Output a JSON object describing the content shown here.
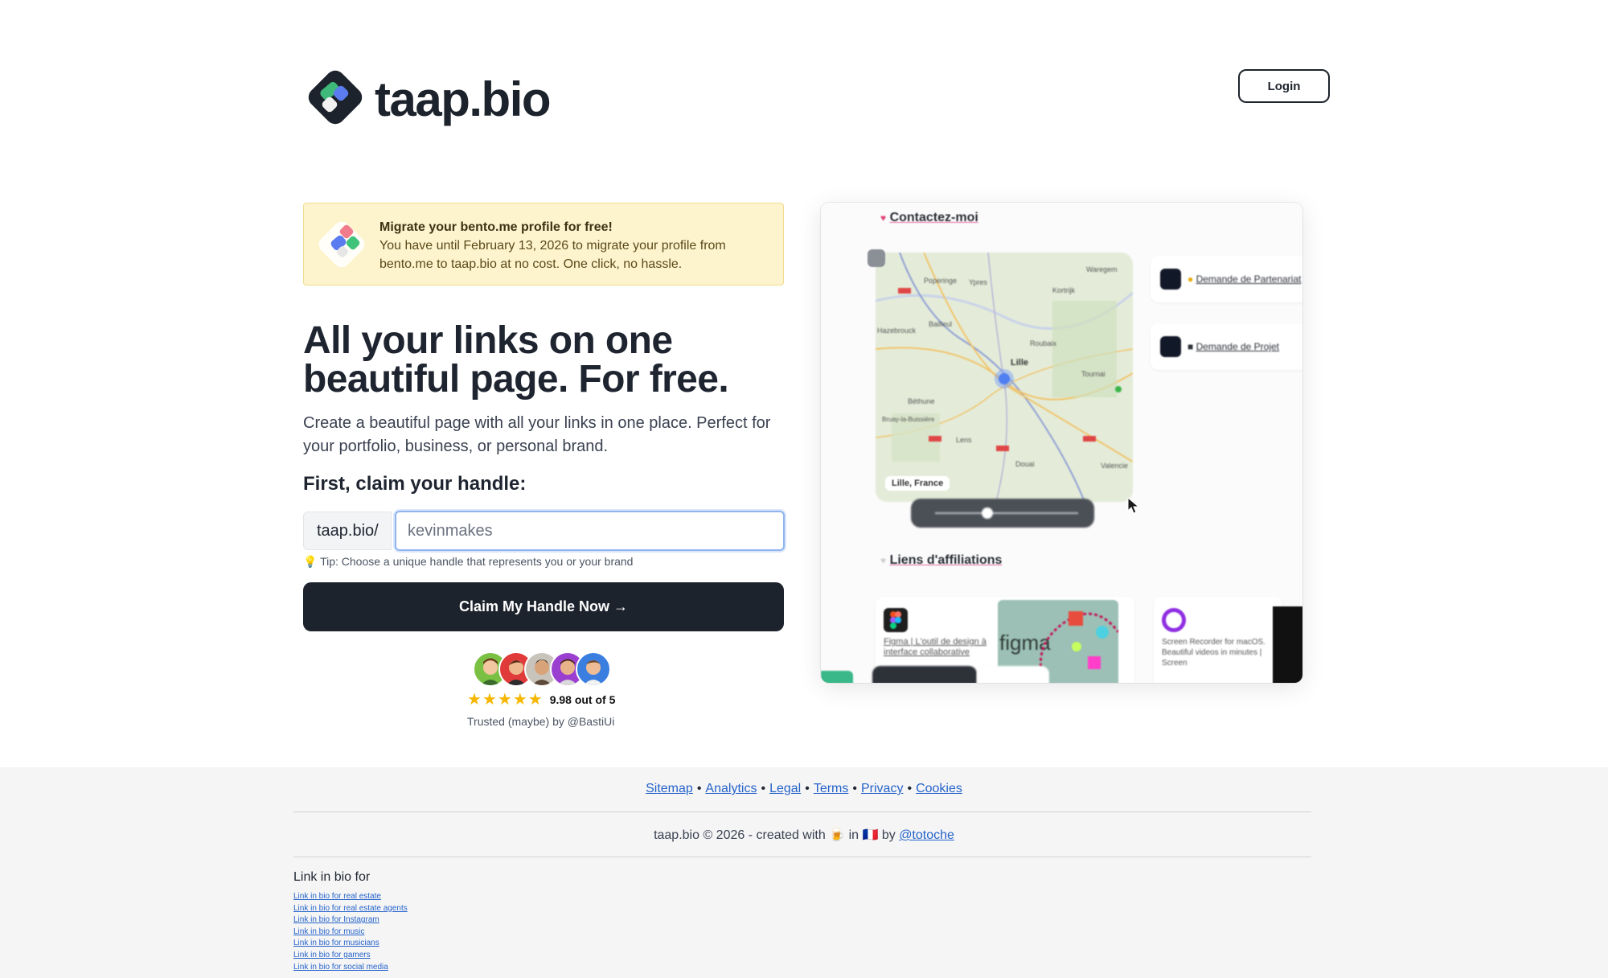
{
  "header": {
    "brand": "taap.bio",
    "login_label": "Login"
  },
  "banner": {
    "title": "Migrate your bento.me profile for free!",
    "body": "You have until February 13, 2026 to migrate your profile from bento.me to taap.bio at no cost. One click, no hassle."
  },
  "hero": {
    "headline": "All your links on one beautiful page. For free.",
    "subtext": "Create a beautiful page with all your links in one place. Perfect for your portfolio, business, or personal brand.",
    "claim_label": "First, claim your handle:",
    "prefix": "taap.bio/",
    "input_placeholder": "kevinmakes",
    "tip": "💡 Tip: Choose a unique handle that represents you or your brand",
    "cta_label": "Claim My Handle Now →"
  },
  "social_proof": {
    "rating": "9.98 out of 5",
    "stars": 5,
    "trusted": "Trusted (maybe) by @BastiUi"
  },
  "preview": {
    "section_contact": "Contactez-moi",
    "map_label": "Lille, France",
    "tile_partner": "Demande de Partenariat",
    "tile_project": "Demande de Projet",
    "section_affiliates": "Liens d'affiliations",
    "figma_text": "Figma | L'outil de design à interface collaborative",
    "figma_image_text": "figma",
    "screen_recorder_text": "Screen Recorder for macOS. Beautiful videos in minutes | Screen",
    "map_places": [
      "Poperinge",
      "Ypres",
      "Kortrijk",
      "Waregem",
      "Hazebrouck",
      "Bailleul",
      "Roubaix",
      "Lille",
      "Tournai",
      "Béthune",
      "Bruay-la-Buissière",
      "Lens",
      "Douai",
      "Valencie"
    ]
  },
  "footer": {
    "links": [
      "Sitemap",
      "Analytics",
      "Legal",
      "Terms",
      "Privacy",
      "Cookies"
    ],
    "copyright_prefix": "taap.bio © 2026 - created with 🍺 in 🇫🇷 by",
    "author": "@totoche",
    "lib_heading": "Link in bio for",
    "lib_links": [
      "Link in bio for real estate",
      "Link in bio for real estate agents",
      "Link in bio for Instagram",
      "Link in bio for music",
      "Link in bio for musicians",
      "Link in bio for gamers",
      "Link in bio for social media"
    ]
  },
  "colors": {
    "primary_dark": "#1d232c",
    "banner_bg": "#fdf3cd",
    "link_blue": "#2563c9",
    "star_gold": "#f5b700",
    "input_focus": "#8fb4ee"
  }
}
